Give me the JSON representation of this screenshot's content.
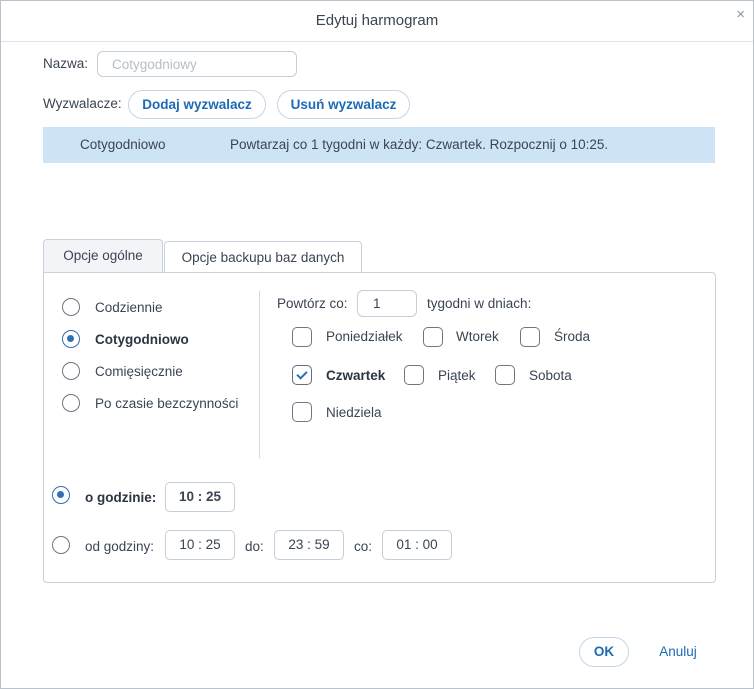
{
  "dialog": {
    "title": "Edytuj harmogram",
    "close_icon": "×"
  },
  "name": {
    "label": "Nazwa:",
    "placeholder": "Cotygodniowy",
    "value": ""
  },
  "triggers": {
    "label": "Wyzwalacze:",
    "add_label": "Dodaj wyzwalacz",
    "remove_label": "Usuń wyzwalacz",
    "rows": [
      {
        "type": "Cotygodniowo",
        "description": "Powtarzaj co 1 tygodni w każdy: Czwartek. Rozpocznij o 10:25."
      }
    ]
  },
  "tabs": [
    {
      "label": "Opcje ogólne",
      "active": true
    },
    {
      "label": "Opcje backupu baz danych",
      "active": false
    }
  ],
  "frequency": {
    "options": [
      {
        "label": "Codziennie",
        "selected": false
      },
      {
        "label": "Cotygodniowo",
        "selected": true
      },
      {
        "label": "Comięsięcznie",
        "selected": false
      },
      {
        "label": "Po czasie bezczynności",
        "selected": false
      }
    ]
  },
  "repeat": {
    "label": "Powtórz co:",
    "value": "1",
    "suffix": "tygodni w dniach:"
  },
  "days": [
    {
      "label": "Poniedziałek",
      "checked": false
    },
    {
      "label": "Wtorek",
      "checked": false
    },
    {
      "label": "Środa",
      "checked": false
    },
    {
      "label": "Czwartek",
      "checked": true
    },
    {
      "label": "Piątek",
      "checked": false
    },
    {
      "label": "Sobota",
      "checked": false
    },
    {
      "label": "Niedziela",
      "checked": false
    }
  ],
  "time": {
    "at_label": "o godzinie:",
    "at_value": "10 : 25",
    "at_selected": true,
    "from_label": "od godziny:",
    "from_value": "10 : 25",
    "to_label": "do:",
    "to_value": "23 : 59",
    "every_label": "co:",
    "every_value": "01 : 00",
    "range_selected": false
  },
  "footer": {
    "ok_label": "OK",
    "cancel_label": "Anuluj"
  },
  "colors": {
    "accent": "#1c6ab5",
    "selected_row": "#cde4f6"
  }
}
